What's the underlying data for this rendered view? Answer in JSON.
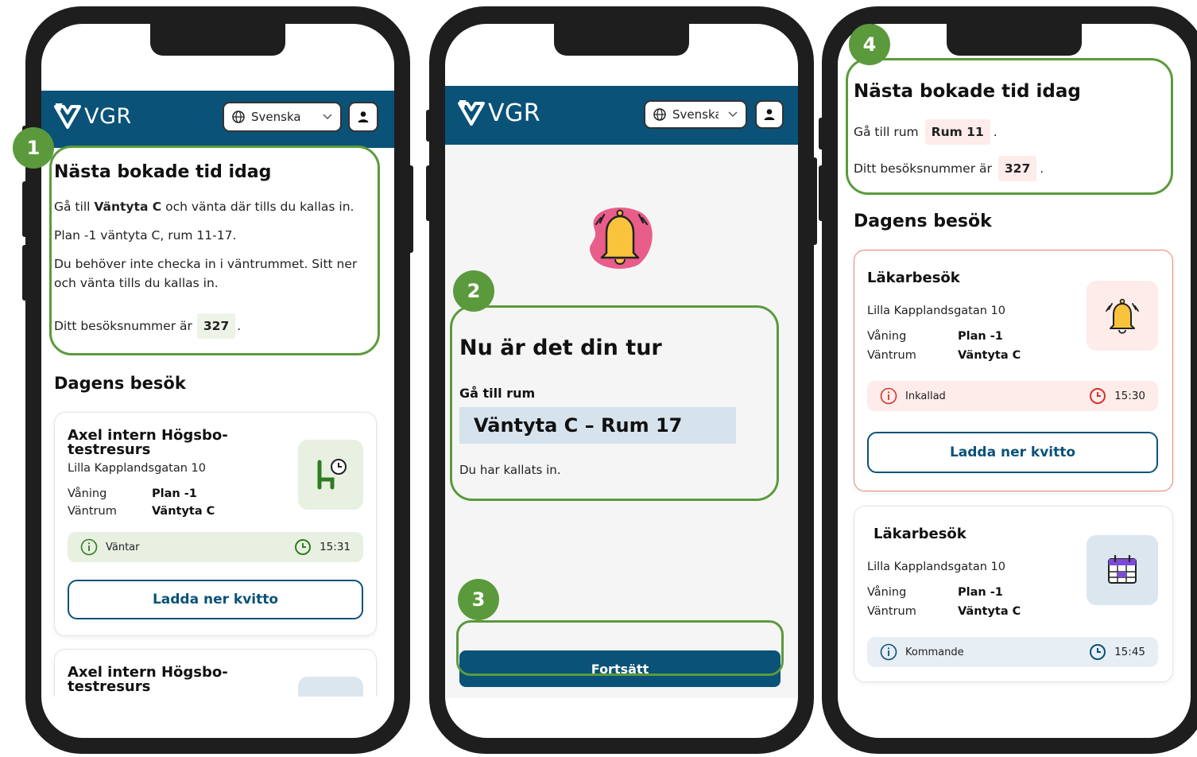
{
  "brand": {
    "logo_text": "VGR",
    "header_color": "#0a5278",
    "accent": "#5b9a3c"
  },
  "language_select": {
    "value_full": "Svenska",
    "value_cut": "Svenska"
  },
  "phone1": {
    "heading": "Nästa bokade tid idag",
    "line1_pre": "Gå till ",
    "line1_bold": "Väntyta C",
    "line1_post": " och vänta där tills du kallas in.",
    "line2": "Plan -1 väntyta C, rum 11-17.",
    "line3": "Du behöver inte checka in i väntrummet. Sitt ner och vänta tills du kallas in.",
    "visit_pre": "Ditt besöksnummer är",
    "visit_number": "327",
    "visit_post": ".",
    "section_title": "Dagens besök",
    "card1": {
      "title": "Axel intern Högsbo-testresurs",
      "address": "Lilla Kapplandsgatan 10",
      "floor_label": "Våning",
      "floor_value": "Plan -1",
      "room_label": "Väntrum",
      "room_value": "Väntyta C",
      "status": "Väntar",
      "time": "15:31",
      "button": "Ladda ner kvitto"
    },
    "card2": {
      "title": "Axel intern Högsbo-testresurs"
    }
  },
  "phone2": {
    "heading": "Nu är det din tur",
    "goto_label": "Gå till rum",
    "room": "Väntyta C – Rum 17",
    "called_text": "Du har kallats in.",
    "continue_button": "Fortsätt"
  },
  "phone3": {
    "heading": "Nästa bokade tid idag",
    "goto_pre": "Gå till rum",
    "room": "Rum 11",
    "goto_post": ".",
    "visit_pre": "Ditt besöksnummer är",
    "visit_number": "327",
    "visit_post": ".",
    "section_title": "Dagens besök",
    "card1": {
      "title": "Läkarbesök",
      "address": "Lilla Kapplandsgatan 10",
      "floor_label": "Våning",
      "floor_value": "Plan -1",
      "room_label": "Väntrum",
      "room_value": "Väntyta C",
      "status": "Inkallad",
      "time": "15:30",
      "button": "Ladda ner kvitto"
    },
    "card2": {
      "title": "Läkarbesök",
      "address": "Lilla Kapplandsgatan 10",
      "floor_label": "Våning",
      "floor_value": "Plan -1",
      "room_label": "Väntrum",
      "room_value": "Väntyta C",
      "status": "Kommande",
      "time": "15:45"
    }
  },
  "callouts": {
    "n1": "1",
    "n2": "2",
    "n3": "3",
    "n4": "4"
  }
}
